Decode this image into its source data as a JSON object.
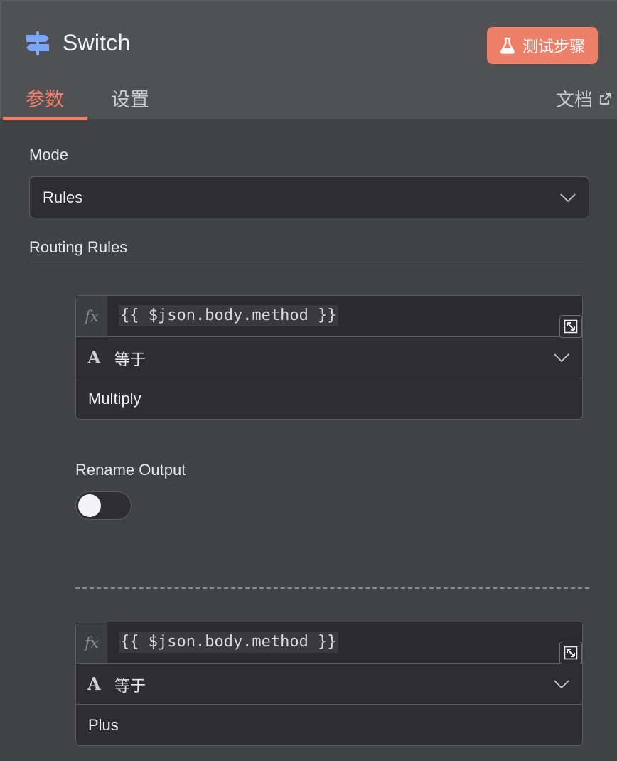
{
  "node": {
    "title": "Switch",
    "icon": "signpost-icon"
  },
  "header": {
    "test_button_label": "测试步骤",
    "test_button_icon": "flask-icon"
  },
  "tabs": {
    "params": "参数",
    "settings": "设置",
    "docs": "文档",
    "active": "params"
  },
  "mode": {
    "label": "Mode",
    "value": "Rules"
  },
  "routing": {
    "label": "Routing Rules"
  },
  "rules": [
    {
      "expression": "{{ $json.body.method }}",
      "type_icon": "A",
      "operator": "等于",
      "value": "Multiply"
    },
    {
      "expression": "{{ $json.body.method }}",
      "type_icon": "A",
      "operator": "等于",
      "value": "Plus"
    }
  ],
  "rename_output": {
    "label": "Rename Output",
    "enabled": false
  },
  "colors": {
    "accent": "#ee7f69",
    "icon_blue": "#7aa6f5",
    "panel": "#414244",
    "header": "#505153"
  }
}
